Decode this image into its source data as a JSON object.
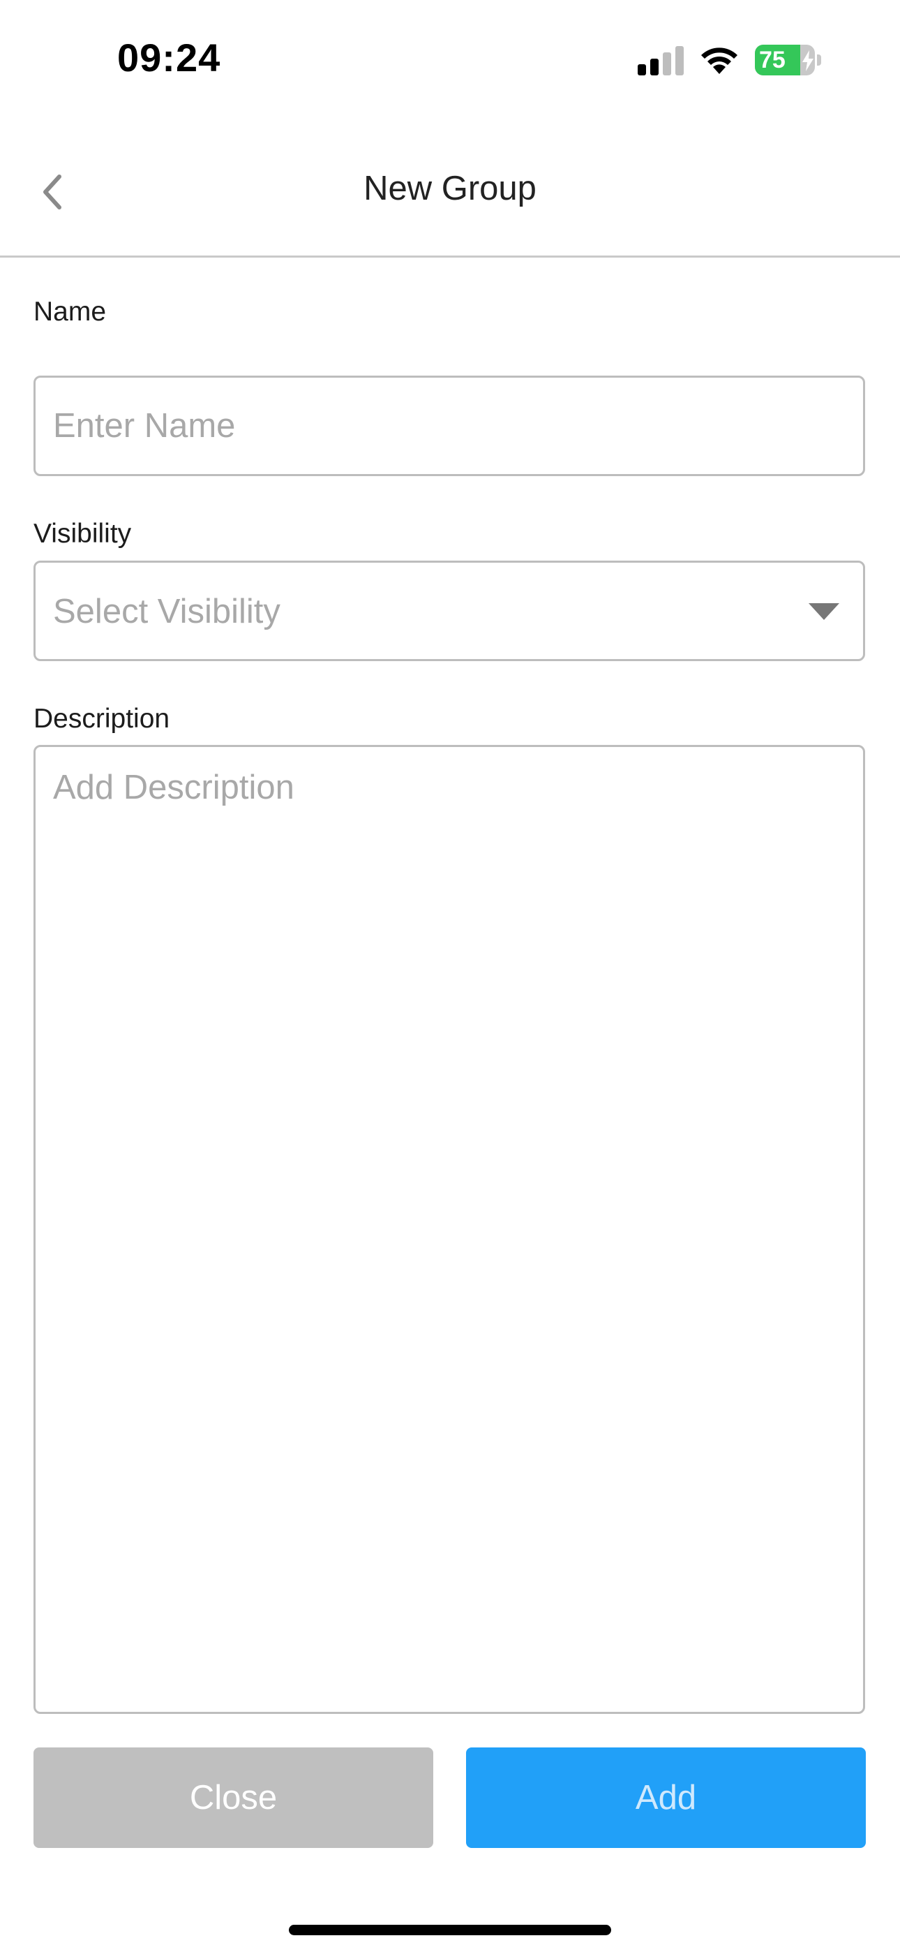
{
  "status_bar": {
    "time": "09:24",
    "battery_level": "75",
    "battery_percent_fill": 75,
    "icons": [
      "signal-icon",
      "wifi-icon",
      "battery-icon",
      "charging-bolt-icon"
    ]
  },
  "header": {
    "title": "New Group",
    "back_icon": "chevron-left-icon"
  },
  "form": {
    "name": {
      "label": "Name",
      "value": "",
      "placeholder": "Enter Name"
    },
    "visibility": {
      "label": "Visibility",
      "selected_value": "",
      "placeholder": "Select Visibility",
      "icon": "caret-down-icon"
    },
    "description": {
      "label": "Description",
      "value": "",
      "placeholder": "Add Description"
    }
  },
  "actions": {
    "close_label": "Close",
    "add_label": "Add"
  },
  "colors": {
    "add_button": "#21a0f8",
    "close_button": "#bfbfbf",
    "battery_fill": "#34c759",
    "placeholder_text": "#a8a8a8",
    "border": "#bdbdbd"
  }
}
